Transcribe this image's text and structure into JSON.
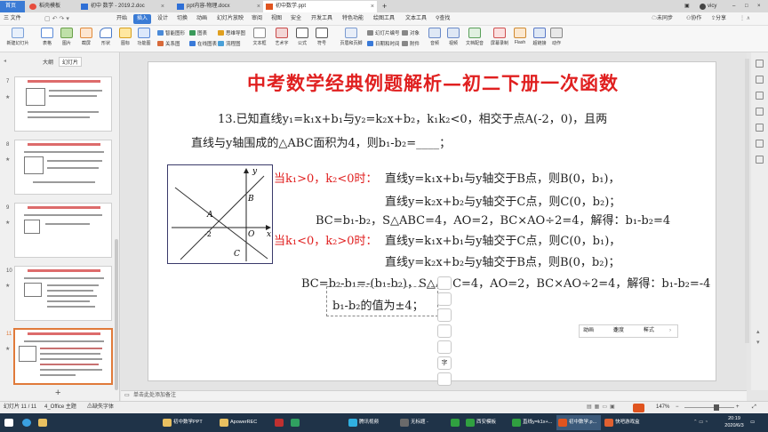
{
  "tabs": [
    {
      "label": "首页",
      "icon": "home-icon"
    },
    {
      "label": "稻壳模板",
      "icon": "docer-icon"
    },
    {
      "label": "初中 数学 - 2019.2.doc",
      "icon": "doc-icon"
    },
    {
      "label": "ppt内容-物理.docx",
      "icon": "doc-icon"
    },
    {
      "label": "初中数学.ppt",
      "icon": "ppt-icon"
    }
  ],
  "add_tab": "+",
  "window_right": {
    "user": "vicy"
  },
  "menu": {
    "file": "三 文件",
    "items": [
      "开始",
      "插入",
      "设计",
      "切换",
      "动画",
      "幻灯片放映",
      "审阅",
      "视图",
      "安全",
      "开发工具",
      "特色功能",
      "绘图工具",
      "文本工具"
    ],
    "active": "插入",
    "search": "查找",
    "sync": "未同步",
    "collab": "协作",
    "share": "分享"
  },
  "ribbon": {
    "big": [
      "新建幻灯片",
      "表格",
      "图片",
      "截屏",
      "形状",
      "图标",
      "功能图"
    ],
    "small_col1": [
      "智能图形",
      "关系图"
    ],
    "small_col2": [
      "图表",
      "在线图表"
    ],
    "small_col3": [
      "思维导图",
      "流程图"
    ],
    "big2": [
      "文本框",
      "艺术字",
      "公式",
      "符号"
    ],
    "small_col4": [
      "幻灯片编号",
      "日期和时间"
    ],
    "small_col5": [
      "对象",
      "附件"
    ],
    "hf": "页眉和页脚",
    "big3": [
      "音频",
      "视频",
      "文档配音",
      "屏幕录制",
      "Flash",
      "超链接",
      "动作"
    ]
  },
  "left_panel": {
    "tab_outline": "大纲",
    "tab_slides": "幻灯片",
    "slide_numbers": [
      "7",
      "8",
      "9",
      "10",
      "11"
    ],
    "add_button": "+"
  },
  "slide": {
    "title": "中考数学经典例题解析—初二下册一次函数",
    "q1": "13.已知直线y₁=k₁x+b₁与y₂=k₂x+b₂，k₁k₂<0，相交于点A(-2，0)，且两",
    "q2": "直线与y轴围成的△ABC面积为4，则b₁-b₂=____；",
    "case1": "当k₁>0，k₂<0时：",
    "l1": "直线y=k₁x+b₁与y轴交于B点，则B(0，b₁)，",
    "l2": "直线y=k₂x+b₂与y轴交于C点，则C(0，b₂)；",
    "l3": "BC=b₁-b₂，S△ABC=4，AO=2，BC×AO÷2=4，解得：b₁-b₂=4",
    "case2": "当k₁<0，k₂>0时：",
    "l4": "直线y=k₁x+b₁与y轴交于C点，则C(0，b₁)，",
    "l5": "直线y=k₂x+b₂与y轴交于B点，则B(0，b₂)；",
    "l6": "BC=b₂-b₁=-(b₁-b₂)，S△ABC=4，AO=2，BC×AO÷2=4，解得：b₁-b₂=-4",
    "l7": "b₁-b₂的值为±4；",
    "graph": {
      "y": "y",
      "x": "x",
      "B": "B",
      "A": "A",
      "O": "O",
      "C": "C",
      "n2": "-2"
    }
  },
  "anim_bar": {
    "anim": "动画",
    "speed": "速度",
    "style": "样式"
  },
  "notes_placeholder": "单击此处添加备注",
  "status": {
    "slide": "幻灯片 11 / 11",
    "theme": "4_Office 主题",
    "font": "缺失字体",
    "zoom": "147%"
  },
  "taskbar": {
    "items": [
      "",
      "",
      "",
      "初中数学PPT",
      "ApowerREC",
      "",
      "",
      "腾讯视频",
      "无标题 -",
      "",
      "西安模板",
      "直线y=k1x+...",
      "初中数学.p...",
      "快吧游戏盒"
    ],
    "time": "20:19",
    "date": "2020/6/3"
  }
}
